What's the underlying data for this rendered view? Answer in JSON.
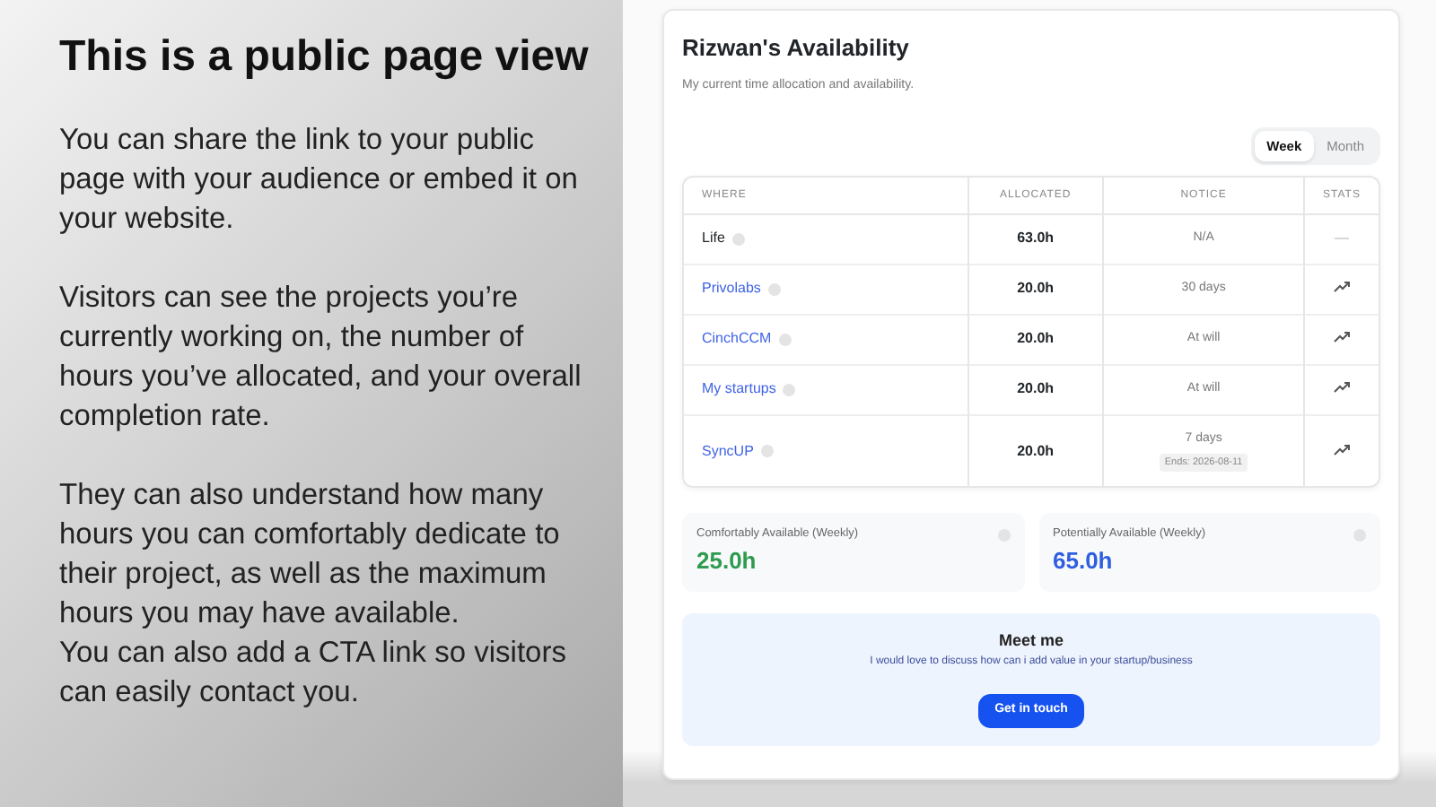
{
  "intro": {
    "title": "This is a public page view",
    "paragraphs": [
      "You can share the link to your public page with your audience or embed it on your website.",
      "Visitors can see the projects you’re currently working on, the number of hours you’ve allocated, and your overall completion rate.",
      "They can also understand how many hours you can comfortably dedicate to their project, as well as the maximum hours you may have available.\nYou can also add a CTA link so visitors can easily contact you."
    ]
  },
  "availability": {
    "title": "Rizwan's Availability",
    "subtitle": "My current time allocation and availability.",
    "period_tabs": [
      {
        "label": "Week",
        "selected": true
      },
      {
        "label": "Month",
        "selected": false
      }
    ],
    "table": {
      "columns": [
        "WHERE",
        "ALLOCATED",
        "NOTICE",
        "STATS"
      ],
      "rows": [
        {
          "where": "Life",
          "link": false,
          "allocated": "63.0h",
          "notice": "N/A",
          "stats": "—",
          "kind": "text"
        },
        {
          "where": "Privolabs",
          "link": true,
          "allocated": "20.0h",
          "notice": "30 days",
          "kind": "trend"
        },
        {
          "where": "CinchCCM",
          "link": true,
          "allocated": "20.0h",
          "notice": "At will",
          "kind": "trend"
        },
        {
          "where": "My startups",
          "link": true,
          "allocated": "20.0h",
          "notice": "At will",
          "kind": "trend"
        },
        {
          "where": "SyncUP",
          "link": true,
          "allocated": "20.0h",
          "notice": "7 days",
          "notice_tag": "Ends: 2026-08-11",
          "kind": "trend"
        }
      ]
    },
    "stats": [
      {
        "label": "Comfortably Available (Weekly)",
        "value": "25.0h",
        "color": "#2e9b4f"
      },
      {
        "label": "Potentially Available (Weekly)",
        "value": "65.0h",
        "color": "#2f5fe0"
      }
    ],
    "cta": {
      "title": "Meet me",
      "text": "I would love to discuss how can i add value in your startup/business",
      "button": "Get in touch"
    }
  }
}
